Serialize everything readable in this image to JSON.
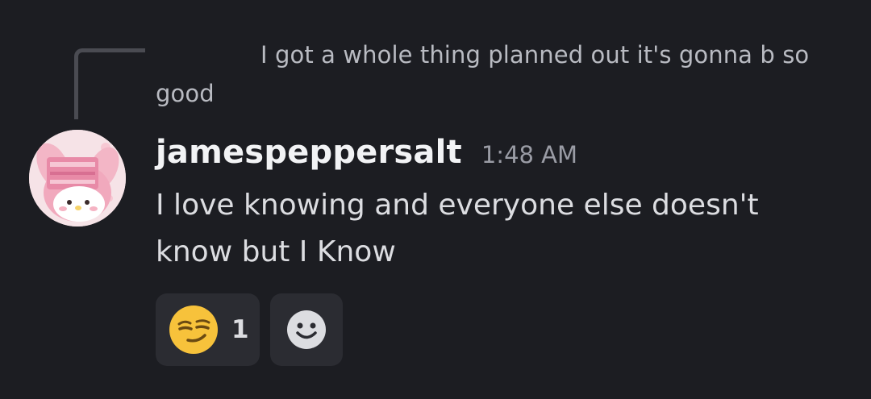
{
  "reply": {
    "preview_text": "I got a whole thing planned out it's gonna b so good"
  },
  "message": {
    "author": "jamespeppersalt",
    "timestamp": "1:48 AM",
    "text": "I love knowing and everyone else doesn't know but I Know",
    "avatar_icon": "my-melody-avatar-icon"
  },
  "reactions": [
    {
      "emoji": "smirking-face-icon",
      "count": "1"
    }
  ],
  "add_reaction": {
    "icon": "smiley-add-reaction-icon"
  },
  "colors": {
    "background": "#1c1d22",
    "reaction_bg": "#2b2c32",
    "username": "#f2f3f5",
    "timestamp": "#9a9ca5"
  }
}
